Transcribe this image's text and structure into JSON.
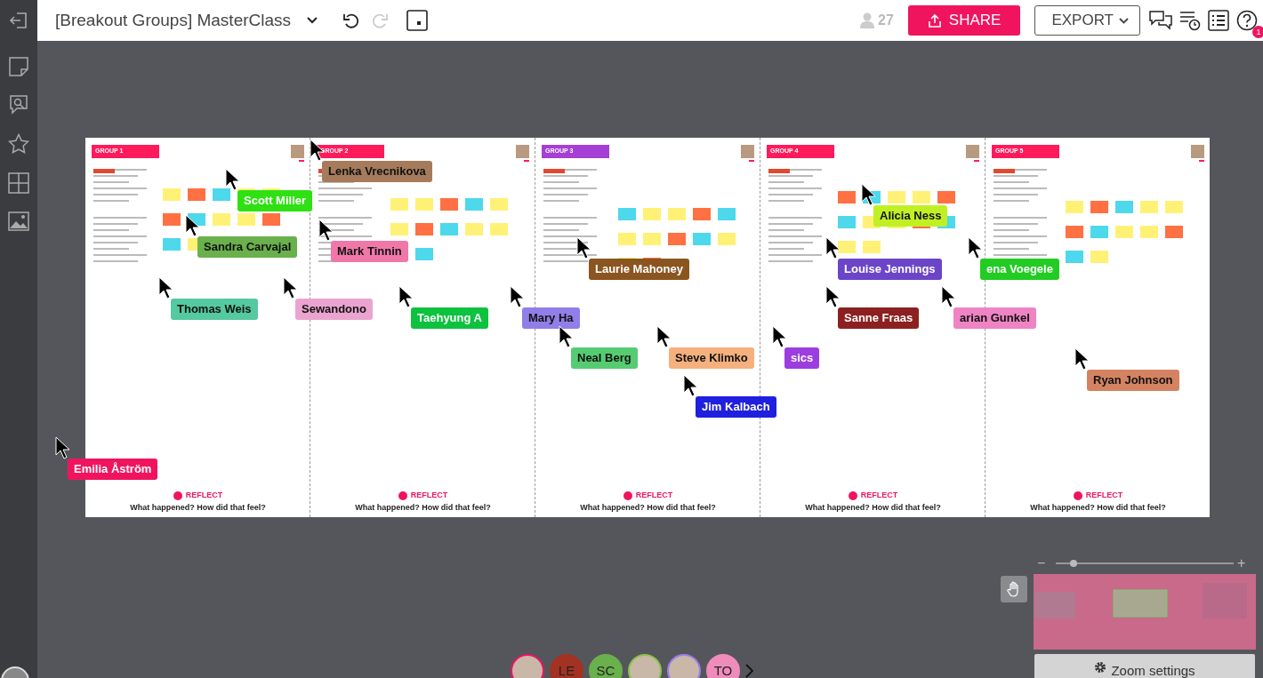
{
  "toolbar": {
    "title": "[Breakout Groups] MasterClass",
    "undo_enabled": true,
    "redo_enabled": false,
    "participants": "27",
    "share": "SHARE",
    "export": "EXPORT",
    "notifications": "1"
  },
  "board": {
    "groups": [
      {
        "title": "GROUP 1",
        "color": "#ff1a5c",
        "reflect": "REFLECT",
        "question": "What happened? How did that feel?"
      },
      {
        "title": "GROUP 2",
        "color": "#ff1a5c",
        "reflect": "REFLECT",
        "question": "What happened? How did that feel?"
      },
      {
        "title": "GROUP 3",
        "color": "#a63fd6",
        "reflect": "REFLECT",
        "question": "What happened? How did that feel?"
      },
      {
        "title": "GROUP 4",
        "color": "#ff1a5c",
        "reflect": "REFLECT",
        "question": "What happened? How did that feel?"
      },
      {
        "title": "GROUP 5",
        "color": "#ff1a5c",
        "reflect": "REFLECT",
        "question": "What happened? How did that feel?"
      }
    ]
  },
  "cursors": [
    {
      "name": "Lenka Vrecnikova",
      "color": "#a67b5b"
    },
    {
      "name": "Scott Miller",
      "color": "#2fe012"
    },
    {
      "name": "Sandra Carvajal",
      "color": "#6ab04c"
    },
    {
      "name": "Mark Tinnin",
      "color": "#ef78a8"
    },
    {
      "name": "Thomas Weis",
      "color": "#55c9a0"
    },
    {
      "name": "Sewandono",
      "color": "#eaa4cf"
    },
    {
      "name": "Taehyung A",
      "color": "#0dc23e"
    },
    {
      "name": "Mary Ha",
      "color": "#927ee8"
    },
    {
      "name": "Laurie Mahoney",
      "color": "#8b5520"
    },
    {
      "name": "Neal Berg",
      "color": "#55cc72"
    },
    {
      "name": "Steve Klimko",
      "color": "#f5b07d"
    },
    {
      "name": "sics",
      "color": "#9c3ddf"
    },
    {
      "name": "Jim Kalbach",
      "color": "#1f1fe0"
    },
    {
      "name": "Alicia Ness",
      "color": "#c0f024"
    },
    {
      "name": "Louise Jennings",
      "color": "#6b45c8"
    },
    {
      "name": "ena Voegele",
      "color": "#22cc22"
    },
    {
      "name": "Sanne Fraas",
      "color": "#8c2020"
    },
    {
      "name": "arian Gunkel",
      "color": "#ef84c4"
    },
    {
      "name": "Ryan Johnson",
      "color": "#d48362"
    },
    {
      "name": "Emilia Åström",
      "color": "#f0145e"
    }
  ],
  "collaborators": [
    {
      "kind": "photo",
      "color": "#f0145e"
    },
    {
      "kind": "initials",
      "initials": "LE",
      "color": "#a33222"
    },
    {
      "kind": "initials",
      "initials": "SC",
      "color": "#6ab04c"
    },
    {
      "kind": "photo",
      "color": "#8bc34a"
    },
    {
      "kind": "photo",
      "color": "#9c7ee8"
    },
    {
      "kind": "initials",
      "initials": "TO",
      "color": "#f08cbc"
    }
  ],
  "zoom": {
    "minus": "−",
    "plus": "+",
    "level": 0.1,
    "settings": "Zoom settings"
  }
}
